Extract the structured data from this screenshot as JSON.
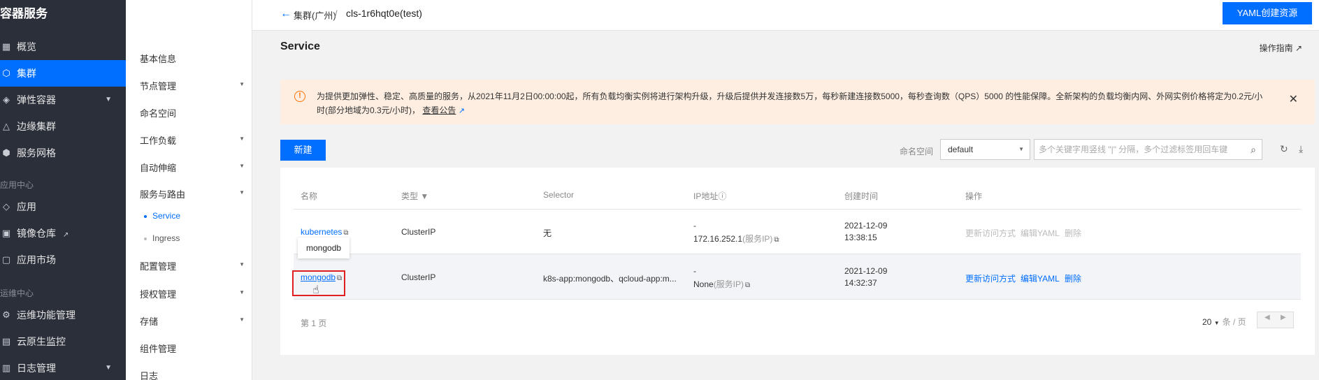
{
  "sidebar": {
    "title": "容器服务",
    "items": [
      {
        "label": "概览",
        "icon": "grid-icon"
      },
      {
        "label": "集群",
        "icon": "cluster-icon",
        "active": true
      },
      {
        "label": "弹性容器",
        "icon": "elastic-icon"
      },
      {
        "label": "边缘集群",
        "icon": "edge-icon"
      },
      {
        "label": "服务网格",
        "icon": "mesh-icon"
      },
      {
        "label": "应用",
        "icon": "app-icon"
      },
      {
        "label": "镜像仓库",
        "icon": "registry-icon"
      },
      {
        "label": "应用市场",
        "icon": "market-icon"
      },
      {
        "label": "运维功能管理",
        "icon": "ops-icon"
      },
      {
        "label": "云原生监控",
        "icon": "monitor-icon"
      },
      {
        "label": "日志管理",
        "icon": "log-icon"
      }
    ],
    "sections": {
      "app_center": "应用中心",
      "ops_center": "运维中心"
    }
  },
  "subnav": {
    "items": [
      "基本信息",
      "节点管理",
      "命名空间",
      "工作负载",
      "自动伸缩",
      "服务与路由",
      "配置管理",
      "授权管理",
      "存储",
      "组件管理",
      "日志"
    ],
    "sub_items": [
      "Service",
      "Ingress"
    ]
  },
  "header": {
    "crumb1": "集群(广州)",
    "separator": "/",
    "crumb2": "cls-1r6hqt0e(test)",
    "yaml_button": "YAML创建资源"
  },
  "main": {
    "title": "Service",
    "guide_link": "操作指南",
    "notice": {
      "text": "为提供更加弹性、稳定、高质量的服务，从2021年11月2日00:00:00起，所有负载均衡实例将进行架构升级，升级后提供并发连接数5万，每秒新建连接数5000，每秒查询数（QPS）5000 的性能保障。全新架构的负载均衡内网、外网实例价格将定为0.2元/小时(部分地域为0.3元/小时)，",
      "link": "查看公告"
    },
    "new_button": "新建",
    "namespace_label": "命名空间",
    "namespace_value": "default",
    "search_placeholder": "多个关键字用竖线 \"|\" 分隔，多个过滤标签用回车键",
    "table": {
      "headers": {
        "name": "名称",
        "type": "类型",
        "selector": "Selector",
        "ip": "IP地址",
        "created": "创建时间",
        "ops": "操作"
      },
      "rows": [
        {
          "name": "kubernetes",
          "type": "ClusterIP",
          "selector": "无",
          "ip_line1": "-",
          "ip_line2": "172.16.252.1",
          "ip_suffix": "(服务IP)",
          "date": "2021-12-09",
          "time": "13:38:15",
          "op1": "更新访问方式",
          "op2": "编辑YAML",
          "op3": "删除"
        },
        {
          "name": "mongodb",
          "type": "ClusterIP",
          "selector": "k8s-app:mongodb、qcloud-app:m...",
          "ip_line1": "-",
          "ip_line2": "None",
          "ip_suffix": "(服务IP)",
          "date": "2021-12-09",
          "time": "14:32:37",
          "op1": "更新访问方式",
          "op2": "编辑YAML",
          "op3": "删除"
        }
      ],
      "tooltip": "mongodb"
    },
    "pager": {
      "label": "第 1 页",
      "page_size": "20",
      "unit": "条 / 页"
    }
  }
}
